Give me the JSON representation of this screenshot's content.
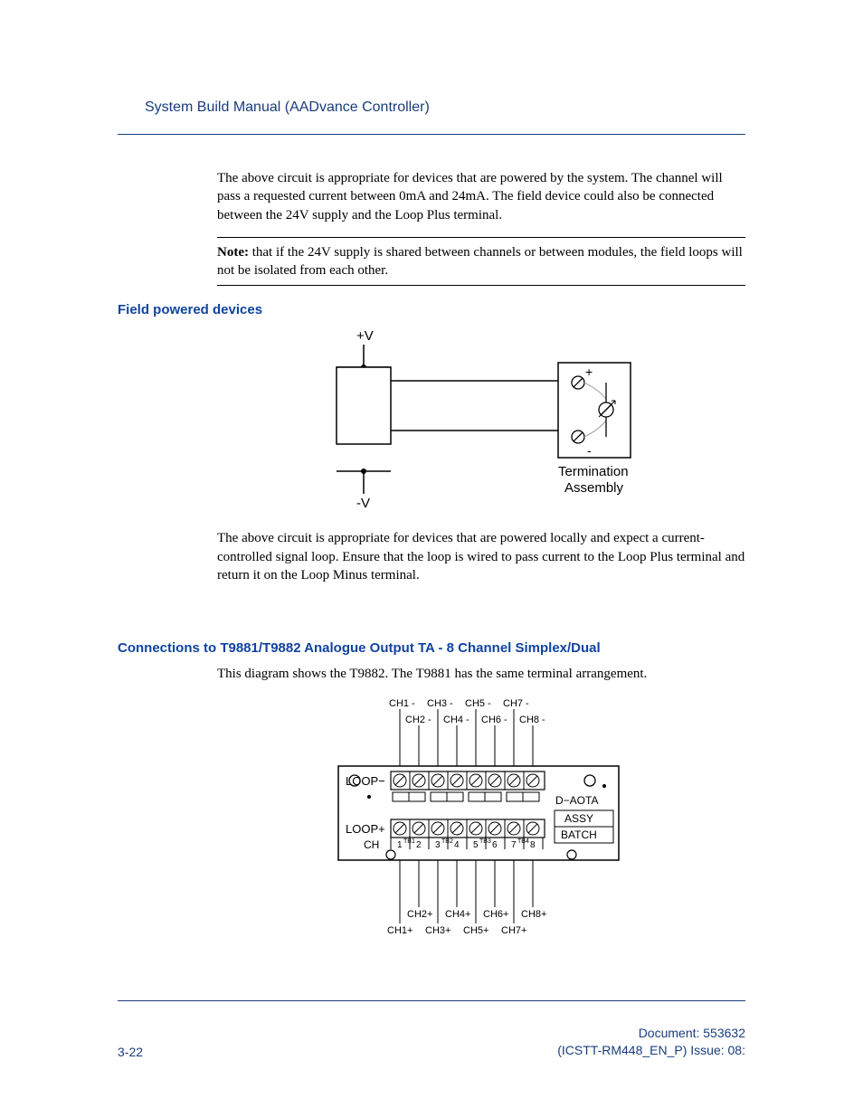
{
  "header": {
    "title": "System Build Manual  (AADvance Controller)"
  },
  "paragraphs": {
    "p1": "The above circuit is appropriate for devices that are powered by the system. The channel will pass a requested current between 0mA and 24mA. The field device could also be connected between the 24V supply and the Loop Plus terminal.",
    "note_label": "Note:",
    "note_text": " that if the 24V supply is shared between channels or between modules, the field loops will not be isolated from each other.",
    "p2": "The above circuit is appropriate for devices that are powered locally and expect a current-controlled signal loop. Ensure that the loop is wired to pass current to the Loop Plus terminal and return it on the Loop Minus terminal.",
    "p3": "This diagram shows the T9882. The T9881 has the same terminal arrangement."
  },
  "sections": {
    "field_powered": "Field powered devices",
    "connections": "Connections to T9881/T9882 Analogue Output TA - 8 Channel Simplex/Dual"
  },
  "figure1": {
    "plus_v": "+V",
    "minus_v": "-V",
    "plus": "+",
    "minus": "-",
    "term_line1": "Termination",
    "term_line2": "Assembly"
  },
  "figure2": {
    "loop_minus": "LOOP−",
    "loop_plus": "LOOP+",
    "ch_label": "CH",
    "d_aota": "D−AOTA",
    "assy": "ASSY",
    "batch": "BATCH",
    "tb1": "TB1",
    "tb2": "TB2",
    "tb3": "TB3",
    "tb4": "TB4",
    "ch_nums": [
      "1",
      "2",
      "3",
      "4",
      "5",
      "6",
      "7",
      "8"
    ],
    "top_labels_upper": [
      "CH1 -",
      "CH3 -",
      "CH5 -",
      "CH7 -"
    ],
    "top_labels_lower": [
      "CH2 -",
      "CH4 -",
      "CH6 -",
      "CH8 -"
    ],
    "bot_labels_upper": [
      "CH2+",
      "CH4+",
      "CH6+",
      "CH8+"
    ],
    "bot_labels_lower": [
      "CH1+",
      "CH3+",
      "CH5+",
      "CH7+"
    ]
  },
  "footer": {
    "page": "3-22",
    "doc_line1": "Document: 553632",
    "doc_line2": "(ICSTT-RM448_EN_P) Issue: 08:"
  }
}
